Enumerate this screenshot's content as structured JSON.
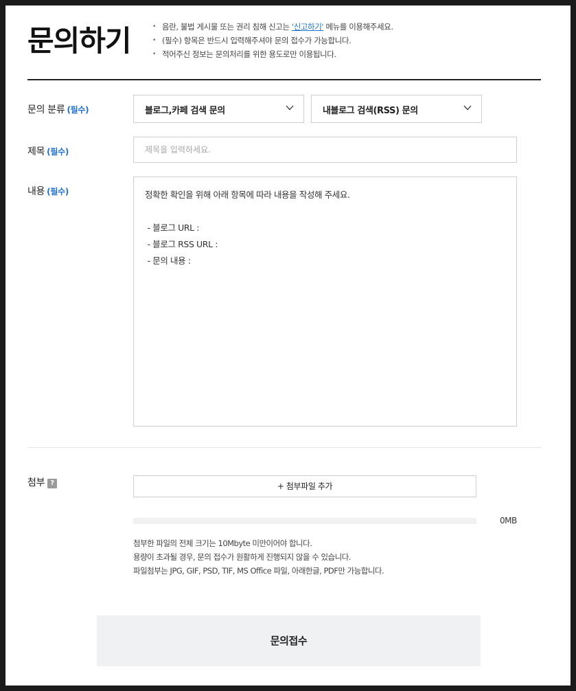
{
  "page": {
    "title": "문의하기",
    "notices": [
      {
        "before": "음란, 불법 게시물 또는 권리 침해 신고는 ",
        "link": "'신고하기'",
        "after": " 메뉴를 이용해주세요."
      },
      {
        "before": "(필수) 항목은 반드시 입력해주셔야 문의 접수가 가능합니다.",
        "link": "",
        "after": ""
      },
      {
        "before": "적어주신 정보는 문의처리를 위한 용도로만 이용됩니다.",
        "link": "",
        "after": ""
      }
    ]
  },
  "form": {
    "required_tag": "(필수)",
    "category": {
      "label": "문의 분류",
      "primary_value": "블로그,카페 검색 문의",
      "secondary_value": "내블로그 검색(RSS) 문의"
    },
    "subject": {
      "label": "제목",
      "value": "",
      "placeholder": "제목을 입력하세요."
    },
    "content": {
      "label": "내용",
      "lines": [
        "정확한 확인을 위해 아래 항목에 따라 내용을 작성해 주세요.",
        "",
        " - 블로그 URL :",
        " - 블로그 RSS URL :",
        " - 문의 내용 :"
      ]
    },
    "attachment": {
      "label": "첨부",
      "help_icon": "question-mark-icon",
      "add_button": "+ 첨부파일 추가",
      "used_fraction": 0,
      "size": "0MB",
      "info_lines": [
        "첨부한 파일의 전체 크기는 10Mbyte 미만이어야 합니다.",
        "용량이 초과될 경우, 문의 접수가 원활하게 진행되지 않을 수 있습니다.",
        "파일첨부는 JPG, GIF, PSD, TIF, MS Office 파일, 아래한글, PDF만 가능합니다."
      ]
    },
    "submit_label": "문의접수"
  },
  "colors": {
    "accent": "#1f6fd0",
    "link": "#1a73c8",
    "submit_bg": "#f0f1f3"
  }
}
